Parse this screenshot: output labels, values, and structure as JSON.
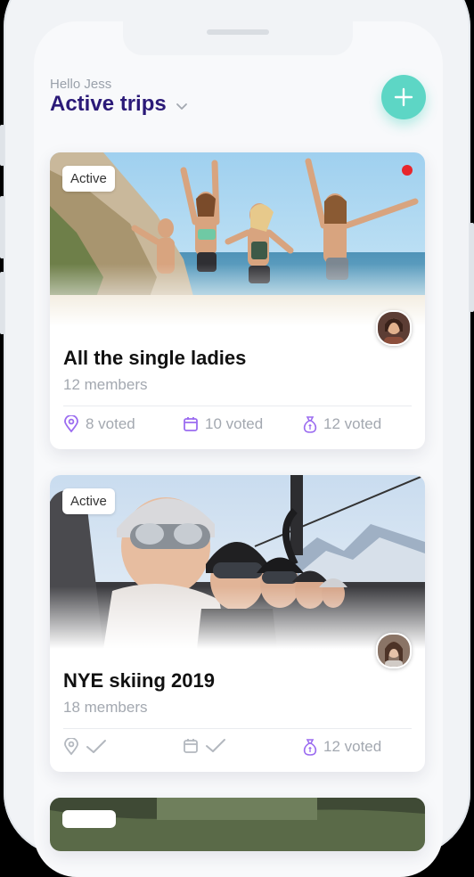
{
  "header": {
    "greeting": "Hello Jess",
    "title": "Active trips"
  },
  "colors": {
    "accent_purple": "#9b6cf0",
    "title_navy": "#2b1a78",
    "add_button": "#5dd6c5",
    "notification_red": "#e8262c"
  },
  "trips": [
    {
      "badge": "Active",
      "title": "All the single ladies",
      "members": "12 members",
      "stats": {
        "location": "8 voted",
        "calendar": "10 voted",
        "budget": "12 voted"
      }
    },
    {
      "badge": "Active",
      "title": "NYE skiing 2019",
      "members": "18 members",
      "stats": {
        "budget": "12 voted"
      }
    }
  ]
}
